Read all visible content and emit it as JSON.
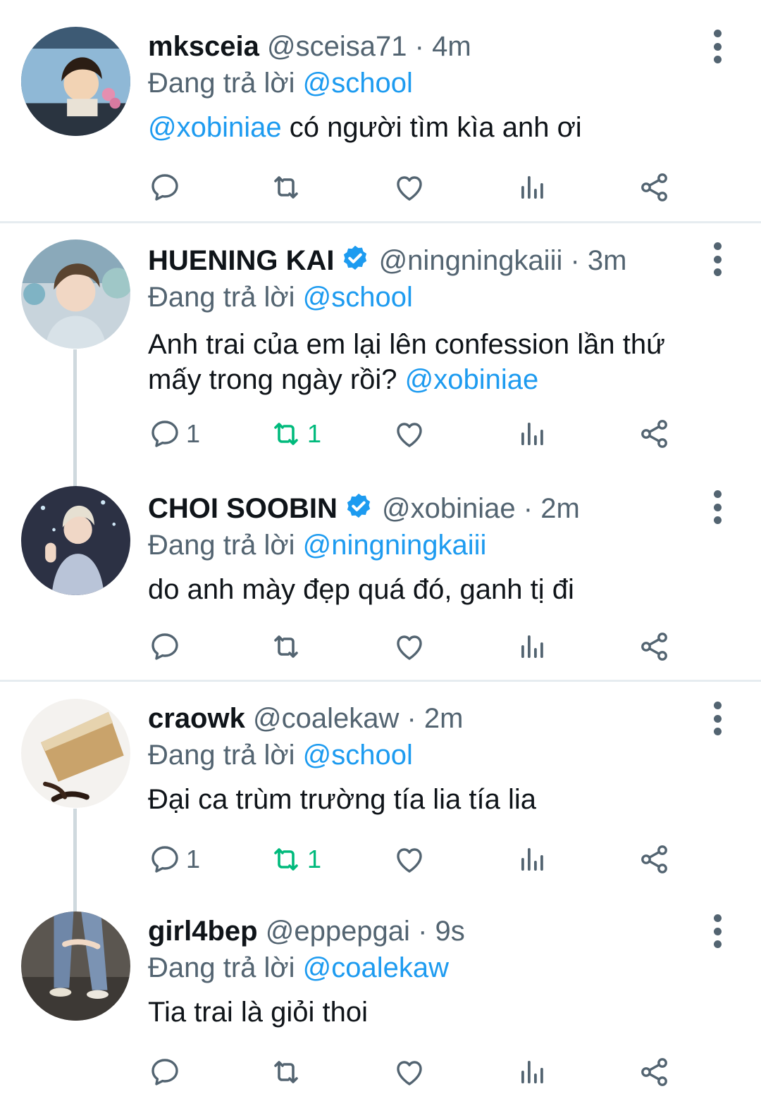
{
  "reply_prefix": "Đang trả lời",
  "tweets": [
    {
      "name": "mksceia",
      "handle": "@sceisa71",
      "time": "4m",
      "verified": false,
      "replying_to": "@school",
      "text_mention_prefix": "@xobiniae",
      "text": " có người tìm kìa anh ơi",
      "reply_count": "",
      "retweet_count": "",
      "retweet_active": false
    },
    {
      "name": "HUENING KAI",
      "handle": "@ningningkaiii",
      "time": "3m",
      "verified": true,
      "replying_to": "@school",
      "text": "Anh trai của em lại lên confession lần thứ mấy trong ngày rồi? ",
      "text_mention_suffix": "@xobiniae",
      "reply_count": "1",
      "retweet_count": "1",
      "retweet_active": true
    },
    {
      "name": "CHOI SOOBIN",
      "handle": "@xobiniae",
      "time": "2m",
      "verified": true,
      "replying_to": "@ningningkaiii",
      "text": "do anh mày đẹp quá đó, ganh tị đi",
      "reply_count": "",
      "retweet_count": "",
      "retweet_active": false
    },
    {
      "name": "craowk",
      "handle": "@coalekaw",
      "time": "2m",
      "verified": false,
      "replying_to": "@school",
      "text": "Đại ca trùm trường tía lia tía lia",
      "reply_count": "1",
      "retweet_count": "1",
      "retweet_active": true
    },
    {
      "name": "girl4bep",
      "handle": "@eppepgai",
      "time": "9s",
      "verified": false,
      "replying_to": "@coalekaw",
      "text": "Tia trai là giỏi thoi",
      "reply_count": "",
      "retweet_count": "",
      "retweet_active": false
    }
  ],
  "colors": {
    "link": "#1d9bf0",
    "muted": "#536471",
    "retweet_active": "#00ba7c",
    "verified": "#1d9bf0"
  },
  "icons": [
    "reply-icon",
    "retweet-icon",
    "like-icon",
    "views-icon",
    "share-icon",
    "more-options-icon",
    "verified-badge-icon"
  ]
}
